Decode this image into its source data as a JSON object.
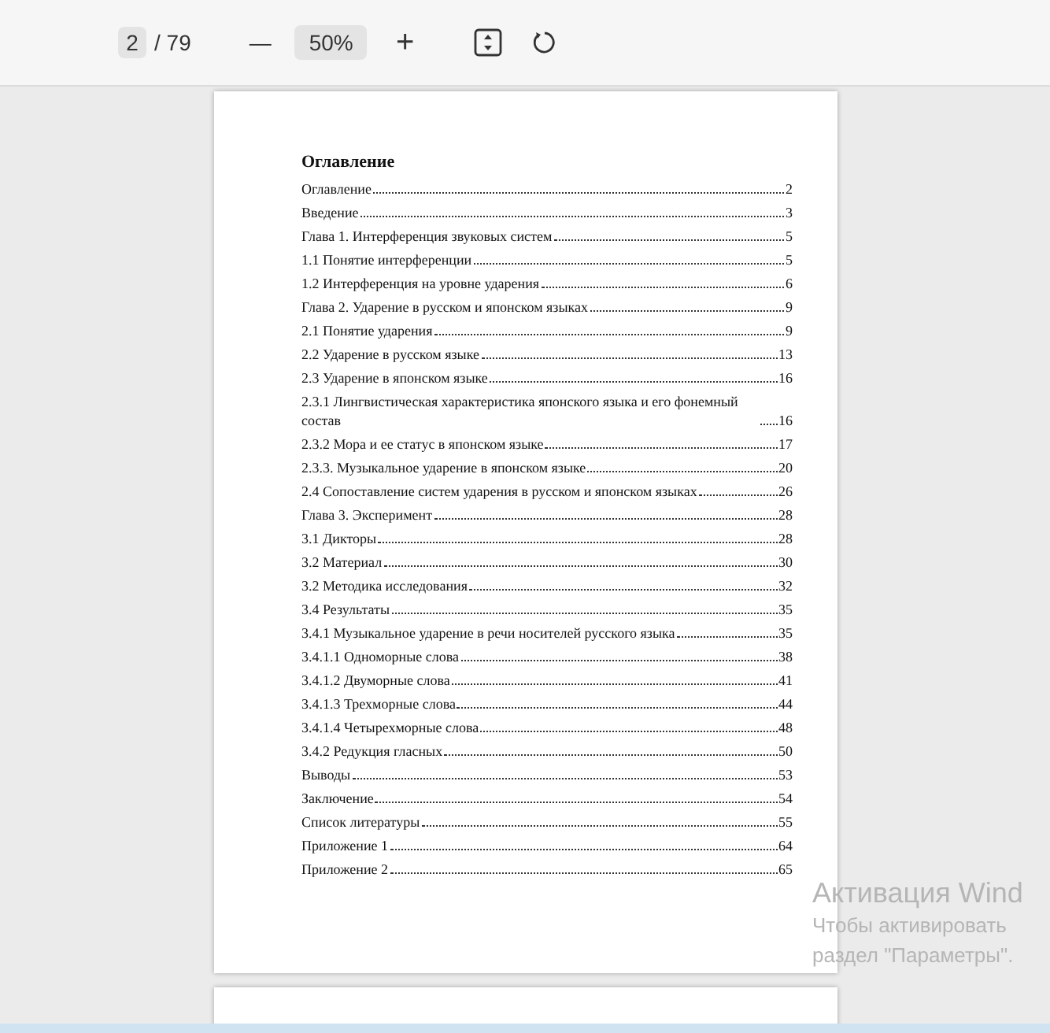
{
  "toolbar": {
    "page_input": "2",
    "page_total": "/ 79",
    "zoom_out": "—",
    "zoom_value": "50%",
    "zoom_in": "+"
  },
  "document": {
    "heading": "Оглавление",
    "entries": [
      {
        "title": "Оглавление",
        "page": "2"
      },
      {
        "title": "Введение",
        "page": "3"
      },
      {
        "title": "Глава 1. Интерференция звуковых систем",
        "page": "5"
      },
      {
        "title": "1.1 Понятие интерференции",
        "page": "5"
      },
      {
        "title": "1.2 Интерференция на уровне ударения",
        "page": "6"
      },
      {
        "title": "Глава 2. Ударение в русском и японском языках",
        "page": "9"
      },
      {
        "title": "2.1 Понятие ударения",
        "page": "9"
      },
      {
        "title": "2.2 Ударение в русском языке",
        "page": "13"
      },
      {
        "title": "2.3 Ударение в японском языке",
        "page": "16"
      },
      {
        "title": "2.3.1 Лингвистическая характеристика японского языка и его фонемный состав",
        "page": "16"
      },
      {
        "title": "2.3.2 Мора и ее статус в японском языке",
        "page": "17"
      },
      {
        "title": "2.3.3. Музыкальное ударение в японском языке",
        "page": "20"
      },
      {
        "title": "2.4 Сопоставление систем ударения в русском и японском языках",
        "page": "26"
      },
      {
        "title": "Глава 3. Эксперимент",
        "page": "28"
      },
      {
        "title": "3.1 Дикторы",
        "page": "28"
      },
      {
        "title": "3.2 Материал",
        "page": "30"
      },
      {
        "title": "3.2 Методика исследования",
        "page": "32"
      },
      {
        "title": "3.4 Результаты",
        "page": "35"
      },
      {
        "title": "3.4.1 Музыкальное ударение в речи носителей русского языка",
        "page": "35"
      },
      {
        "title": "3.4.1.1 Одноморные слова",
        "page": "38"
      },
      {
        "title": "3.4.1.2 Двуморные слова",
        "page": "41"
      },
      {
        "title": "3.4.1.3 Трехморные слова",
        "page": "44"
      },
      {
        "title": "3.4.1.4 Четырехморные слова",
        "page": "48"
      },
      {
        "title": "3.4.2 Редукция гласных",
        "page": "50"
      },
      {
        "title": "Выводы",
        "page": "53"
      },
      {
        "title": "Заключение",
        "page": "54"
      },
      {
        "title": "Список литературы",
        "page": "55"
      },
      {
        "title": "Приложение 1",
        "page": "64"
      },
      {
        "title": "Приложение 2",
        "page": "65"
      }
    ]
  },
  "activation_notice": {
    "title": "Активация Wind",
    "line_1": "Чтобы активировать",
    "line_2": "раздел \"Параметры\"."
  }
}
